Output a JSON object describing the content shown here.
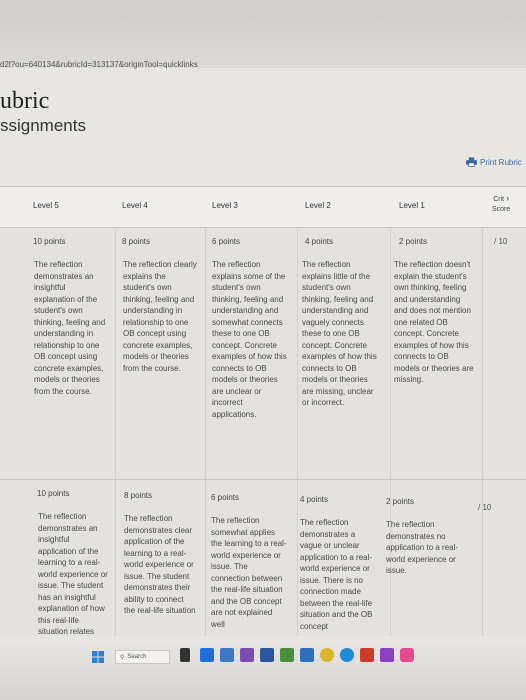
{
  "browser": {
    "url": "d2l?ou=640134&rubricId=313137&originTool=quicklinks"
  },
  "page": {
    "title": "Rubric",
    "subtitle": "Assignments",
    "title_visible": "ubric",
    "subtitle_visible": "ssignments"
  },
  "actions": {
    "print": "Print Rubric"
  },
  "table": {
    "headers": [
      "Level 5",
      "Level 4",
      "Level 3",
      "Level 2",
      "Level 1"
    ],
    "criteria_header": "Crit",
    "score_header": "Score",
    "rows": [
      {
        "points": [
          "10 points",
          "8 points",
          "6 points",
          "4 points",
          "2 points"
        ],
        "score": "/ 10",
        "cells": [
          "The reflection demonstrates an insightful explanation of the student's own thinking, feeling and understanding in relationship to one OB concept using concrete examples, models or theories from the course.",
          "The reflection clearly explains the student's own thinking, feeling and understanding in relationship to one OB concept using concrete examples, models or theories from the course.",
          "The reflection explains some of the student's own thinking, feeling and understanding and somewhat connects these to one OB concept. Concrete examples of how this connects to OB models or theories are unclear or incorrect applications.",
          "The reflection explains little of the student's own thinking, feeling and understanding and vaguely connects these to one OB concept. Concrete examples of how this connects to OB models or theories are missing, unclear or incorrect.",
          "The reflection doesn't explain the student's own thinking, feeling and understanding and does not mention one related OB concept. Concrete examples of how this connects to OB models or theories are missing."
        ]
      },
      {
        "points": [
          "10 points",
          "8 points",
          "6 points",
          "4 points",
          "2 points"
        ],
        "score": "/ 10",
        "cells": [
          "The reflection demonstrates an insightful application of the learning to a real-world experience or issue. The student has an insightful explanation of how this real-life situation relates",
          "The reflection demonstrates clear application of the learning to a real-world experience or issue. The student demonstrates their ability to connect the real-life situation",
          "The reflection somewhat applies the learning to a real-world experience or issue. The connection between the real-life situation and the OB concept are not explained well",
          "The reflection demonstrates a vague or unclear application to a real-world experience or issue. There is no connection made between the real-life situation and the OB concept",
          "The reflection demonstrates no application to a real-world experience or issue."
        ]
      }
    ]
  },
  "taskbar": {
    "search": "Search"
  }
}
